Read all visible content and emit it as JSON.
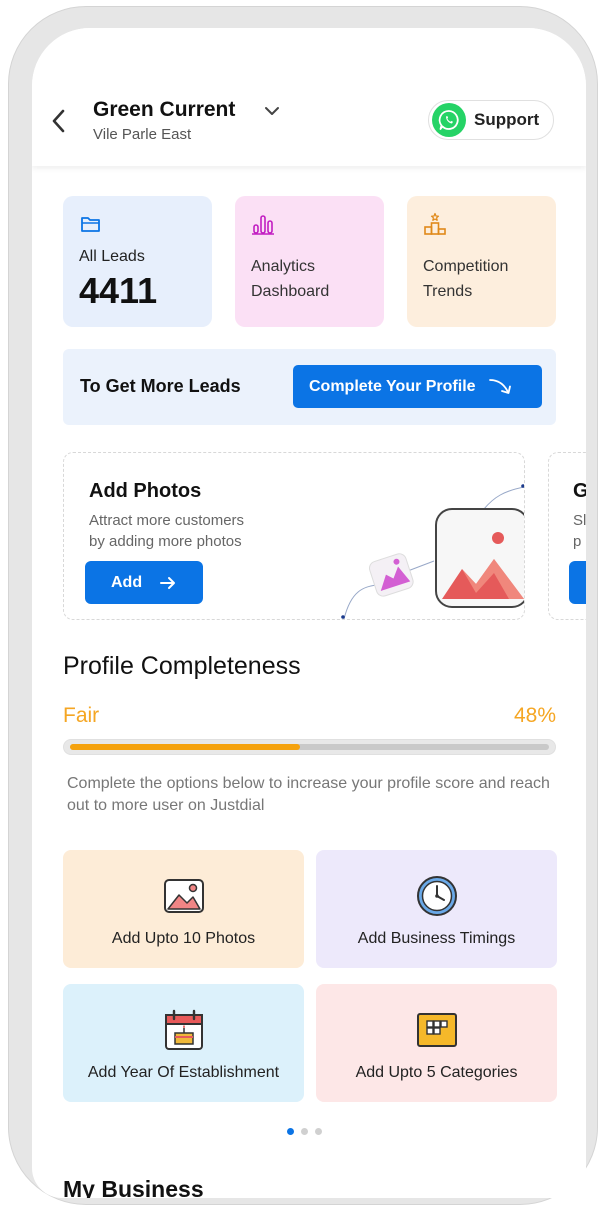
{
  "header": {
    "business_name": "Green Current",
    "location": "Vile Parle East",
    "support_label": "Support"
  },
  "top_cards": {
    "leads_label": "All Leads",
    "leads_count": "4411",
    "analytics_line1": "Analytics",
    "analytics_line2": "Dashboard",
    "competition_line1": "Competition",
    "competition_line2": "Trends"
  },
  "banner": {
    "text": "To Get More Leads",
    "button_label": "Complete Your Profile"
  },
  "photos_card": {
    "title": "Add Photos",
    "desc_line1": "Attract more customers",
    "desc_line2": "by adding more photos",
    "button_label": "Add"
  },
  "peek_card": {
    "title_partial": "G",
    "desc_line1_partial": "Sl",
    "desc_line2_partial": "p"
  },
  "profile": {
    "title": "Profile Completeness",
    "level": "Fair",
    "percent_label": "48%",
    "percent_value": 0.48,
    "description": "Complete the options below to increase your profile score and reach out to more user on Justdial"
  },
  "options": [
    {
      "label": "Add Upto 10 Photos",
      "icon": "photo-icon"
    },
    {
      "label": "Add Business Timings",
      "icon": "clock-icon"
    },
    {
      "label": "Add Year Of Establishment",
      "icon": "calendar-cake-icon"
    },
    {
      "label": "Add Upto 5 Categories",
      "icon": "categories-grid-icon"
    }
  ],
  "pagination": {
    "total": 3,
    "active_index": 0
  },
  "my_business": {
    "title": "My Business"
  },
  "colors": {
    "accent": "#0b74e5",
    "progress": "#f5a20d",
    "fair": "#f5a623",
    "whatsapp": "#25d366"
  }
}
